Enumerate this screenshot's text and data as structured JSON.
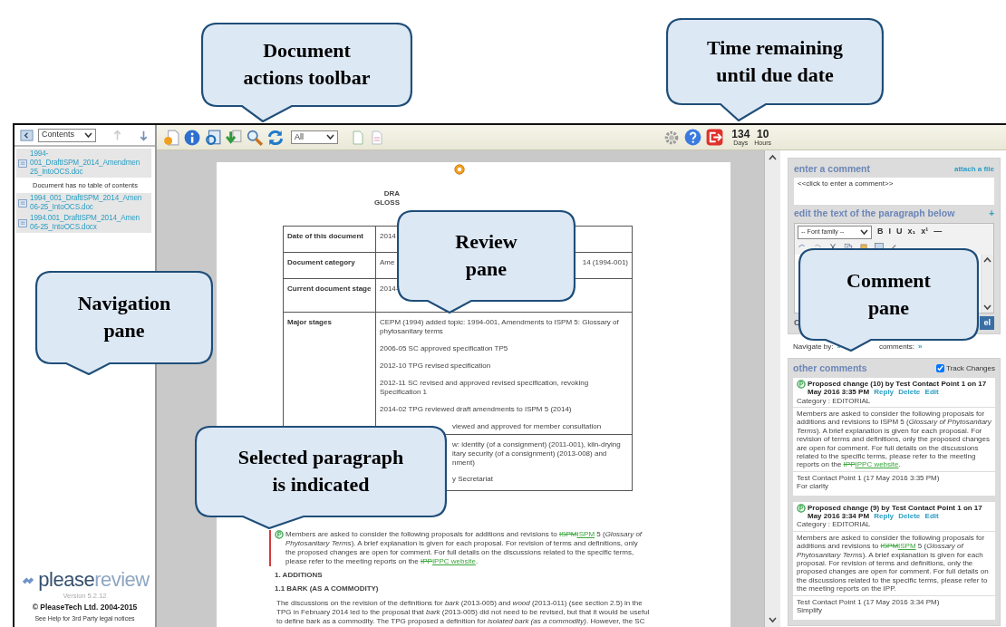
{
  "callouts": [
    {
      "lines": [
        "Document",
        "actions toolbar"
      ]
    },
    {
      "lines": [
        "Time remaining",
        "until due date"
      ]
    },
    {
      "lines": [
        "Navigation",
        "pane"
      ]
    },
    {
      "lines": [
        "Review",
        "pane"
      ]
    },
    {
      "lines": [
        "Selected paragraph",
        "is indicated"
      ]
    },
    {
      "lines": [
        "Comment",
        "pane"
      ]
    }
  ],
  "navigation": {
    "view_select": "Contents",
    "items": [
      {
        "kind": "file",
        "lines": [
          "1994-",
          "001_DraftISPM_2014_Amendmen",
          "25_IntoOCS.doc"
        ]
      },
      {
        "kind": "note",
        "lines": [
          "Document has no table of contents"
        ]
      },
      {
        "kind": "file",
        "lines": [
          "1994_001_DraftISPM_2014_Amen",
          "06-25_IntoOCS.doc"
        ]
      },
      {
        "kind": "file",
        "lines": [
          "1994.001_DraftISPM_2014_Amen",
          "06-25_IntoOCS.docx"
        ]
      }
    ],
    "logo_prefix": "please",
    "logo_suffix": "review",
    "version": "Version 5.2.12",
    "copyright": "© PleaseTech Ltd. 2004-2015",
    "legal": "See Help for 3rd Party legal notices"
  },
  "toolbar": {
    "filter_select": "All",
    "days": "134",
    "hours": "10",
    "days_label": "Days",
    "hours_label": "Hours"
  },
  "document": {
    "title_lines": [
      "DRA",
      "GLOSS"
    ],
    "table": [
      {
        "label": "Date of this document",
        "paragraphs": [
          {
            "kind": "start",
            "text": "2014"
          }
        ]
      },
      {
        "label": "Document category",
        "paragraphs": [
          {
            "kind": "start",
            "text": "Ame"
          },
          {
            "kind": "end",
            "text": "14 (1994-001)"
          }
        ]
      },
      {
        "label": "Current document stage",
        "paragraphs": [
          {
            "kind": "start",
            "text": "2014-"
          }
        ]
      },
      {
        "label": "Major stages",
        "paragraphs": [
          {
            "kind": "full",
            "text": "CEPM (1994) added topic: 1994-001, Amendments to ISPM 5: Glossary of phytosanitary terms"
          },
          {
            "kind": "full",
            "text": "2006-05 SC approved specification TP5"
          },
          {
            "kind": "full",
            "text": "2012-10 TPG revised specification"
          },
          {
            "kind": "full",
            "text": "2012-11 SC revised and approved revised specification, revoking Specification 1"
          },
          {
            "kind": "full",
            "text": "2014-02 TPG reviewed draft amendments to ISPM 5 (2014)"
          },
          {
            "kind": "tail",
            "text": "viewed and approved for member consultation"
          }
        ]
      },
      {
        "paragraphs": [
          {
            "kind": "tail",
            "text": "w: identity (of a consignment) (2011-001), kiln-drying"
          },
          {
            "kind": "tail",
            "text": "itary security (of a consignment) (2013-008) and"
          },
          {
            "kind": "tail",
            "text": "nment)"
          },
          {
            "kind": "tail",
            "text": "y Secretariat"
          }
        ]
      }
    ],
    "sections": [
      {
        "kind": "paragraph",
        "selected": true,
        "segments": [
          {
            "kind": "text",
            "text": "Members are asked to consider the following proposals for additions and revisions to "
          },
          {
            "kind": "deleted",
            "text": "ISPM"
          },
          {
            "kind": "inserted",
            "text": "ISPM"
          },
          {
            "kind": "text",
            "text": " 5 ("
          },
          {
            "kind": "italic",
            "text": "Glossary of Phytosanitary Terms"
          },
          {
            "kind": "text",
            "text": "). A brief explanation is given for each proposal. For revision of terms and definitions, only the proposed changes are open for comment. For full details on the discussions related to the specific terms, please refer to the meeting reports on the "
          },
          {
            "kind": "deleted",
            "text": "IPP"
          },
          {
            "kind": "inserted",
            "text": "IPPC website"
          },
          {
            "kind": "text",
            "text": "."
          }
        ]
      },
      {
        "kind": "heading",
        "text": "1. ADDITIONS"
      },
      {
        "kind": "heading",
        "text": "1.1 BARK (AS A COMMODITY)"
      },
      {
        "kind": "paragraph",
        "selected": false,
        "segments": [
          {
            "kind": "text",
            "text": "The discussions on the revision of the definitions for "
          },
          {
            "kind": "italic",
            "text": "bark"
          },
          {
            "kind": "text",
            "text": " (2013-005) and "
          },
          {
            "kind": "italic",
            "text": "wood"
          },
          {
            "kind": "text",
            "text": " (2013-011) (see section 2.5) in the TPG in February 2014 led to the proposal that "
          },
          {
            "kind": "italic",
            "text": "bark"
          },
          {
            "kind": "text",
            "text": " (2013-005) did not need to be revised, but that it would be useful to define bark as a commodity. The TPG proposed a definition for "
          },
          {
            "kind": "italic",
            "text": "isolated bark (as a commodity)"
          },
          {
            "kind": "text",
            "text": ". However, the SC"
          }
        ]
      }
    ]
  },
  "comment_pane": {
    "enter_title": "enter a comment",
    "attach_link": "attach a file",
    "comment_placeholder": "<<click to enter a comment>>",
    "edit_title": "edit the text of the paragraph below",
    "expand_glyph": "+",
    "font_select": "-- Font family --",
    "format_buttons": [
      "B",
      "I",
      "U",
      "x₁",
      "x¹",
      "—"
    ],
    "partial_label": "C",
    "partial_button": "el",
    "navigate_label": "Navigate by:",
    "navigate_glyph": "»",
    "comments_label": "comments:",
    "comments_glyph": "»",
    "other_title": "other comments",
    "track_changes": {
      "label": "Track Changes",
      "checked": true
    },
    "comments": [
      {
        "heading": "Proposed change (10) by Test Contact Point 1 on 17 May 2016 3:35 PM",
        "actions": [
          "Reply",
          "Delete",
          "Edit"
        ],
        "category": "Category : EDITORIAL",
        "body": [
          {
            "kind": "text",
            "text": "Members are asked to consider the following proposals for additions and revisions to ISPM 5 ("
          },
          {
            "kind": "italic",
            "text": "Glossary of Phytosanitary Terms"
          },
          {
            "kind": "text",
            "text": "). A brief explanation is given for each proposal. For revision of terms and definitions, only the proposed changes are open for comment. For full details on the discussions related to the specific terms, please refer to the meeting reports on the "
          },
          {
            "kind": "deleted",
            "text": "IPP"
          },
          {
            "kind": "inserted",
            "text": "IPPC website"
          },
          {
            "kind": "text",
            "text": "."
          }
        ],
        "author_line": "Test Contact Point 1 (17 May 2016 3:35 PM)",
        "note": "For clarity"
      },
      {
        "heading": "Proposed change (9) by Test Contact Point 1 on 17 May 2016 3:34 PM",
        "actions": [
          "Reply",
          "Delete",
          "Edit"
        ],
        "category": "Category : EDITORIAL",
        "body": [
          {
            "kind": "text",
            "text": "Members are asked to consider the following proposals for additions and revisions to "
          },
          {
            "kind": "deleted",
            "text": "ISPM"
          },
          {
            "kind": "inserted",
            "text": "ISPM"
          },
          {
            "kind": "text",
            "text": " 5 ("
          },
          {
            "kind": "italic",
            "text": "Glossary of Phytosanitary Terms"
          },
          {
            "kind": "text",
            "text": "). A brief explanation is given for each proposal. For revision of terms and definitions, only the proposed changes are open for comment. For full details on the discussions related to the specific terms, please refer to the meeting reports on the IPP."
          }
        ],
        "author_line": "Test Contact Point 1 (17 May 2016 3:34 PM)",
        "note": "Simplify"
      }
    ]
  }
}
